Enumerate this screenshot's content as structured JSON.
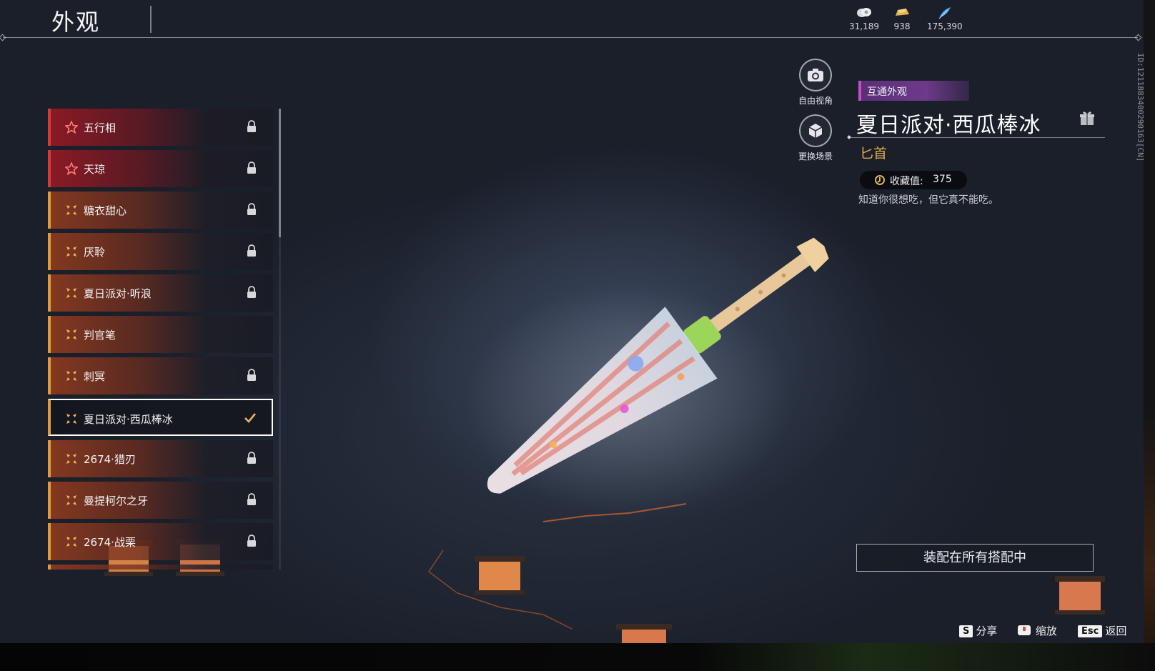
{
  "header": {
    "title": "外观",
    "currencies": [
      {
        "icon": "silver-coin-icon",
        "value": "31,189"
      },
      {
        "icon": "gold-ingot-icon",
        "value": "938"
      },
      {
        "icon": "blue-feather-icon",
        "value": "175,390"
      }
    ]
  },
  "list": {
    "items": [
      {
        "label": "五行相",
        "tier": "red",
        "locked": true
      },
      {
        "label": "天琼",
        "tier": "red",
        "locked": true
      },
      {
        "label": "糖衣甜心",
        "tier": "orange",
        "locked": true
      },
      {
        "label": "厌聆",
        "tier": "orange",
        "locked": true
      },
      {
        "label": "夏日派对·听浪",
        "tier": "orange",
        "locked": true
      },
      {
        "label": "判官笔",
        "tier": "orange",
        "locked": false
      },
      {
        "label": "刺冥",
        "tier": "orange",
        "locked": true
      },
      {
        "label": "夏日派对·西瓜棒冰",
        "tier": "orange",
        "locked": false,
        "selected": true
      },
      {
        "label": "2674·猎刃",
        "tier": "orange",
        "locked": true
      },
      {
        "label": "曼提柯尔之牙",
        "tier": "orange",
        "locked": true
      },
      {
        "label": "2674·战栗",
        "tier": "orange",
        "locked": true
      }
    ]
  },
  "side_buttons": {
    "free_view": "自由视角",
    "change_scene": "更换场景"
  },
  "detail": {
    "tag": "互通外观",
    "name": "夏日派对·西瓜棒冰",
    "type": "匕首",
    "collect_label": "收藏值:",
    "collect_value": "375",
    "description": "知道你很想吃，但它真不能吃。",
    "id_text": "ID:1211883400290163[CN]",
    "equip_button": "装配在所有搭配中"
  },
  "hints": {
    "share_key": "S",
    "share_label": "分享",
    "zoom_label": "缩放",
    "back_key": "Esc",
    "back_label": "返回"
  },
  "colors": {
    "tier_red": "#d83a3a",
    "tier_orange": "#e09a3c",
    "tag_purple": "#6d3a8a",
    "type_gold": "#e0a94a"
  }
}
